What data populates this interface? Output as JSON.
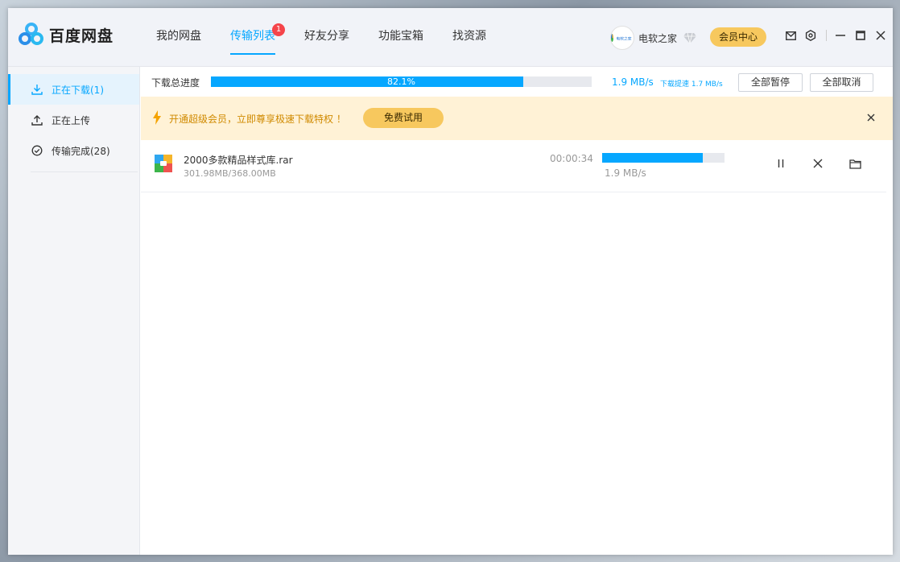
{
  "header": {
    "app_name": "百度网盘",
    "nav": [
      {
        "label": "我的网盘"
      },
      {
        "label": "传输列表",
        "badge": "1"
      },
      {
        "label": "好友分享"
      },
      {
        "label": "功能宝箱"
      },
      {
        "label": "找资源"
      }
    ],
    "user": {
      "avatar_text": "电软之家",
      "name": "电软之家"
    },
    "vip_label": "会员中心"
  },
  "sidebar": {
    "items": [
      {
        "label": "正在下载(1)",
        "icon": "download-icon"
      },
      {
        "label": "正在上传",
        "icon": "upload-icon"
      },
      {
        "label": "传输完成(28)",
        "icon": "check-circle-icon"
      }
    ]
  },
  "progress": {
    "label": "下载总进度",
    "percent": 82.1,
    "percent_text": "82.1%",
    "speed": "1.9 MB/s",
    "speed_limit": "下载提速 1.7 MB/s",
    "pause_all": "全部暂停",
    "cancel_all": "全部取消"
  },
  "promo": {
    "text": "开通超级会员，立即尊享极速下载特权 ！",
    "button": "免费试用"
  },
  "task": {
    "name": "2000多款精品样式库.rar",
    "size": "301.98MB/368.00MB",
    "time_left": "00:00:34",
    "progress": 0.82,
    "speed": "1.9 MB/s"
  },
  "colors": {
    "accent": "#06a7ff",
    "vip": "#f7c85e",
    "promo_bg": "#fff2d6",
    "badge": "#f5444a"
  }
}
